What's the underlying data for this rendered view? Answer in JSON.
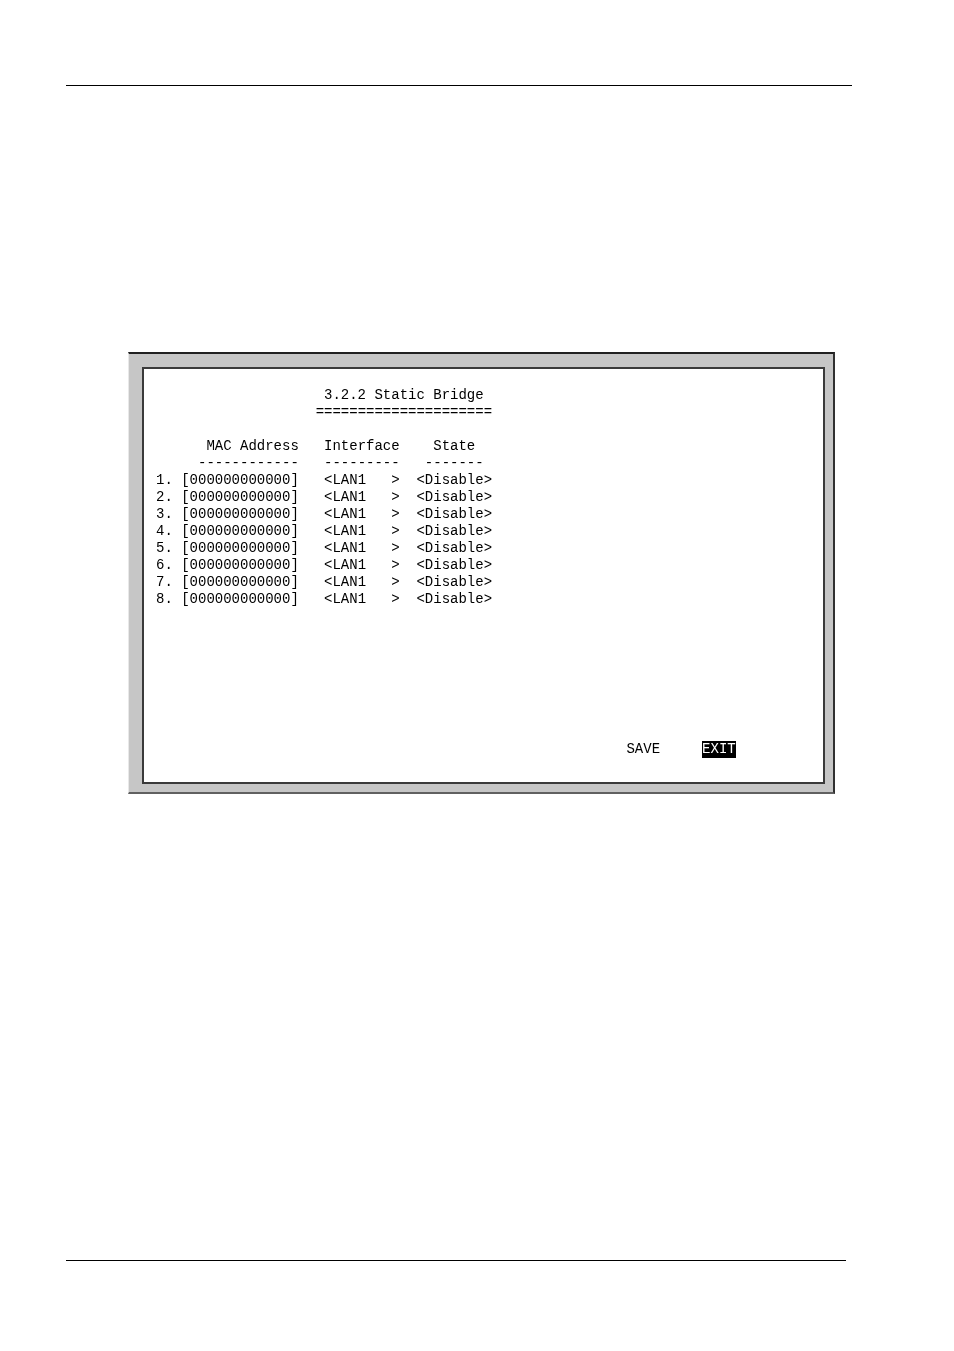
{
  "screen": {
    "title": "3.2.2 Static Bridge",
    "title_rule": "=====================",
    "columns": [
      {
        "label": "MAC Address",
        "rule": "------------"
      },
      {
        "label": "Interface",
        "rule": "---------"
      },
      {
        "label": "State",
        "rule": "-------"
      }
    ],
    "rows": [
      {
        "number": "1.",
        "mac_address": "[000000000000]",
        "interface": "<LAN1   >",
        "state": "<Disable>"
      },
      {
        "number": "2.",
        "mac_address": "[000000000000]",
        "interface": "<LAN1   >",
        "state": "<Disable>"
      },
      {
        "number": "3.",
        "mac_address": "[000000000000]",
        "interface": "<LAN1   >",
        "state": "<Disable>"
      },
      {
        "number": "4.",
        "mac_address": "[000000000000]",
        "interface": "<LAN1   >",
        "state": "<Disable>"
      },
      {
        "number": "5.",
        "mac_address": "[000000000000]",
        "interface": "<LAN1   >",
        "state": "<Disable>"
      },
      {
        "number": "6.",
        "mac_address": "[000000000000]",
        "interface": "<LAN1   >",
        "state": "<Disable>"
      },
      {
        "number": "7.",
        "mac_address": "[000000000000]",
        "interface": "<LAN1   >",
        "state": "<Disable>"
      },
      {
        "number": "8.",
        "mac_address": "[000000000000]",
        "interface": "<LAN1   >",
        "state": "<Disable>"
      }
    ],
    "buttons": [
      {
        "label": "SAVE",
        "selected": false
      },
      {
        "label": "EXIT",
        "selected": true
      }
    ]
  }
}
